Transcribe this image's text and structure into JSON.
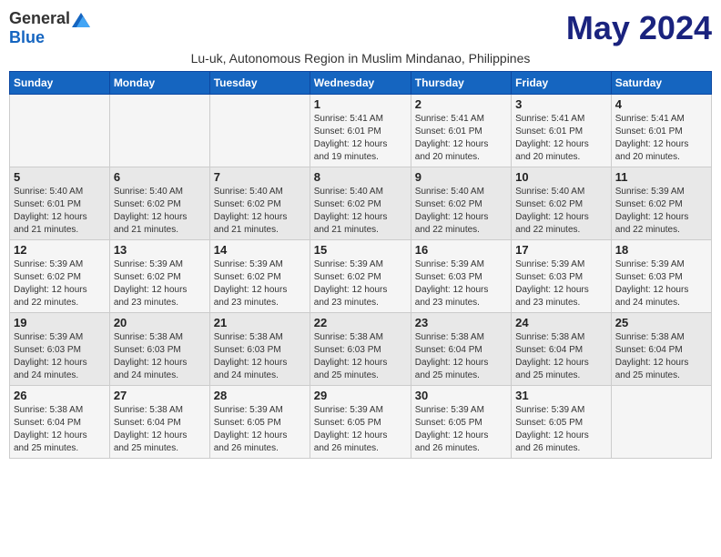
{
  "header": {
    "logo_general": "General",
    "logo_blue": "Blue",
    "month_title": "May 2024",
    "subtitle": "Lu-uk, Autonomous Region in Muslim Mindanao, Philippines"
  },
  "weekdays": [
    "Sunday",
    "Monday",
    "Tuesday",
    "Wednesday",
    "Thursday",
    "Friday",
    "Saturday"
  ],
  "weeks": [
    {
      "days": [
        {
          "number": "",
          "info": ""
        },
        {
          "number": "",
          "info": ""
        },
        {
          "number": "",
          "info": ""
        },
        {
          "number": "1",
          "info": "Sunrise: 5:41 AM\nSunset: 6:01 PM\nDaylight: 12 hours\nand 19 minutes."
        },
        {
          "number": "2",
          "info": "Sunrise: 5:41 AM\nSunset: 6:01 PM\nDaylight: 12 hours\nand 20 minutes."
        },
        {
          "number": "3",
          "info": "Sunrise: 5:41 AM\nSunset: 6:01 PM\nDaylight: 12 hours\nand 20 minutes."
        },
        {
          "number": "4",
          "info": "Sunrise: 5:41 AM\nSunset: 6:01 PM\nDaylight: 12 hours\nand 20 minutes."
        }
      ]
    },
    {
      "days": [
        {
          "number": "5",
          "info": "Sunrise: 5:40 AM\nSunset: 6:01 PM\nDaylight: 12 hours\nand 21 minutes."
        },
        {
          "number": "6",
          "info": "Sunrise: 5:40 AM\nSunset: 6:02 PM\nDaylight: 12 hours\nand 21 minutes."
        },
        {
          "number": "7",
          "info": "Sunrise: 5:40 AM\nSunset: 6:02 PM\nDaylight: 12 hours\nand 21 minutes."
        },
        {
          "number": "8",
          "info": "Sunrise: 5:40 AM\nSunset: 6:02 PM\nDaylight: 12 hours\nand 21 minutes."
        },
        {
          "number": "9",
          "info": "Sunrise: 5:40 AM\nSunset: 6:02 PM\nDaylight: 12 hours\nand 22 minutes."
        },
        {
          "number": "10",
          "info": "Sunrise: 5:40 AM\nSunset: 6:02 PM\nDaylight: 12 hours\nand 22 minutes."
        },
        {
          "number": "11",
          "info": "Sunrise: 5:39 AM\nSunset: 6:02 PM\nDaylight: 12 hours\nand 22 minutes."
        }
      ]
    },
    {
      "days": [
        {
          "number": "12",
          "info": "Sunrise: 5:39 AM\nSunset: 6:02 PM\nDaylight: 12 hours\nand 22 minutes."
        },
        {
          "number": "13",
          "info": "Sunrise: 5:39 AM\nSunset: 6:02 PM\nDaylight: 12 hours\nand 23 minutes."
        },
        {
          "number": "14",
          "info": "Sunrise: 5:39 AM\nSunset: 6:02 PM\nDaylight: 12 hours\nand 23 minutes."
        },
        {
          "number": "15",
          "info": "Sunrise: 5:39 AM\nSunset: 6:02 PM\nDaylight: 12 hours\nand 23 minutes."
        },
        {
          "number": "16",
          "info": "Sunrise: 5:39 AM\nSunset: 6:03 PM\nDaylight: 12 hours\nand 23 minutes."
        },
        {
          "number": "17",
          "info": "Sunrise: 5:39 AM\nSunset: 6:03 PM\nDaylight: 12 hours\nand 23 minutes."
        },
        {
          "number": "18",
          "info": "Sunrise: 5:39 AM\nSunset: 6:03 PM\nDaylight: 12 hours\nand 24 minutes."
        }
      ]
    },
    {
      "days": [
        {
          "number": "19",
          "info": "Sunrise: 5:39 AM\nSunset: 6:03 PM\nDaylight: 12 hours\nand 24 minutes."
        },
        {
          "number": "20",
          "info": "Sunrise: 5:38 AM\nSunset: 6:03 PM\nDaylight: 12 hours\nand 24 minutes."
        },
        {
          "number": "21",
          "info": "Sunrise: 5:38 AM\nSunset: 6:03 PM\nDaylight: 12 hours\nand 24 minutes."
        },
        {
          "number": "22",
          "info": "Sunrise: 5:38 AM\nSunset: 6:03 PM\nDaylight: 12 hours\nand 25 minutes."
        },
        {
          "number": "23",
          "info": "Sunrise: 5:38 AM\nSunset: 6:04 PM\nDaylight: 12 hours\nand 25 minutes."
        },
        {
          "number": "24",
          "info": "Sunrise: 5:38 AM\nSunset: 6:04 PM\nDaylight: 12 hours\nand 25 minutes."
        },
        {
          "number": "25",
          "info": "Sunrise: 5:38 AM\nSunset: 6:04 PM\nDaylight: 12 hours\nand 25 minutes."
        }
      ]
    },
    {
      "days": [
        {
          "number": "26",
          "info": "Sunrise: 5:38 AM\nSunset: 6:04 PM\nDaylight: 12 hours\nand 25 minutes."
        },
        {
          "number": "27",
          "info": "Sunrise: 5:38 AM\nSunset: 6:04 PM\nDaylight: 12 hours\nand 25 minutes."
        },
        {
          "number": "28",
          "info": "Sunrise: 5:39 AM\nSunset: 6:05 PM\nDaylight: 12 hours\nand 26 minutes."
        },
        {
          "number": "29",
          "info": "Sunrise: 5:39 AM\nSunset: 6:05 PM\nDaylight: 12 hours\nand 26 minutes."
        },
        {
          "number": "30",
          "info": "Sunrise: 5:39 AM\nSunset: 6:05 PM\nDaylight: 12 hours\nand 26 minutes."
        },
        {
          "number": "31",
          "info": "Sunrise: 5:39 AM\nSunset: 6:05 PM\nDaylight: 12 hours\nand 26 minutes."
        },
        {
          "number": "",
          "info": ""
        }
      ]
    }
  ]
}
